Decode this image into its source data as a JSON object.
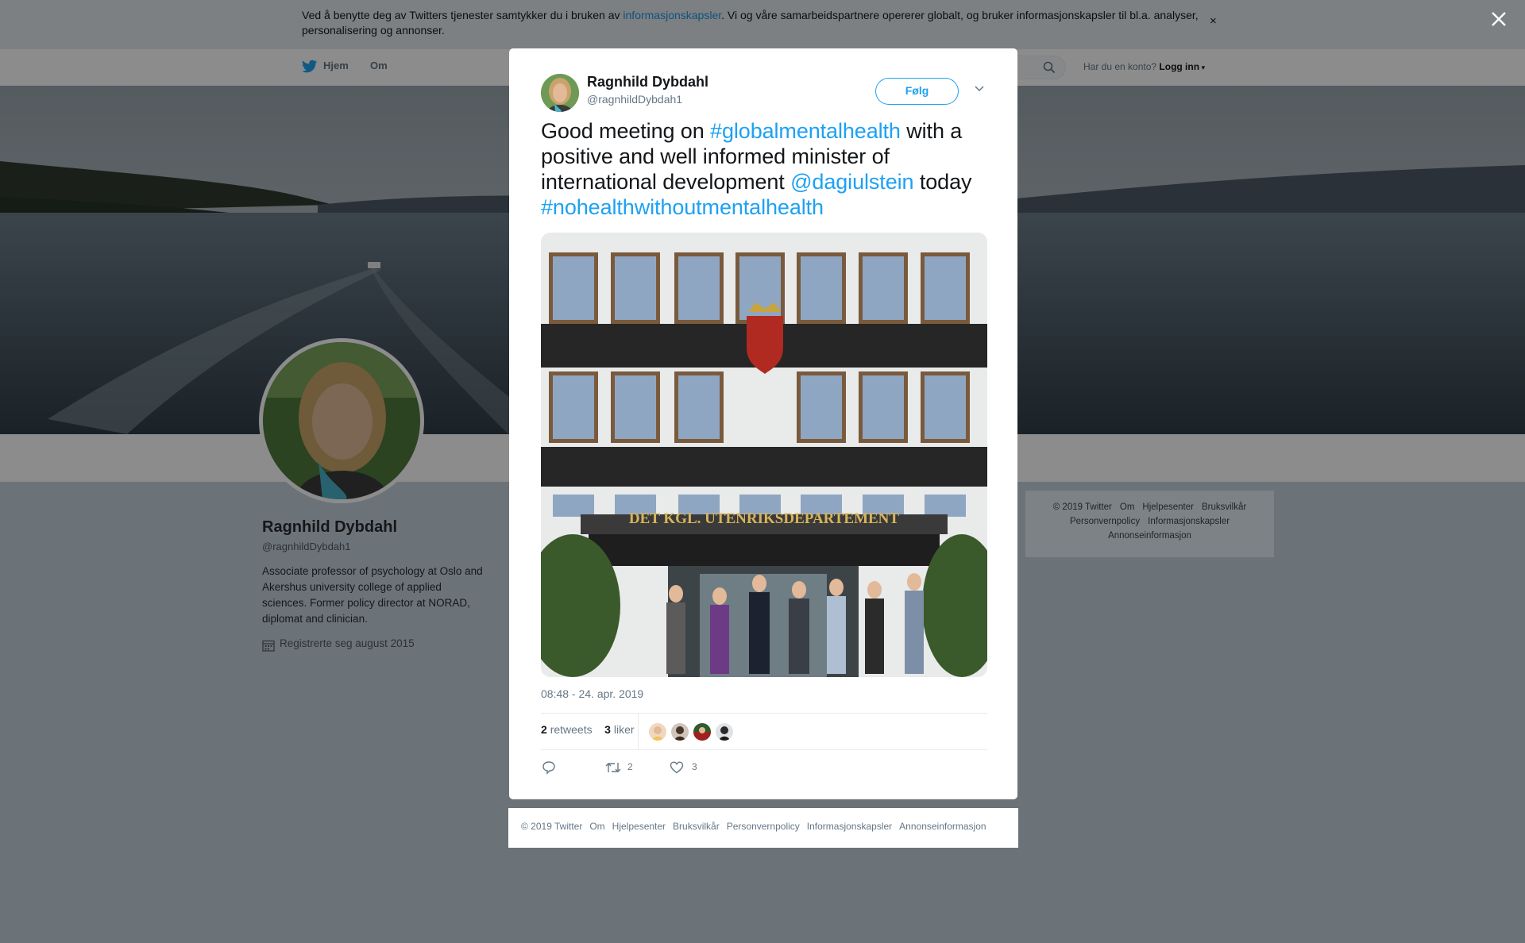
{
  "cookie_banner": {
    "text_before": "Ved å benytte deg av Twitters tjenester samtykker du i bruken av ",
    "link": "informasjonskapsler",
    "text_after": ". Vi og våre samarbeidspartnere opererer globalt, og bruker informasjonskapsler til bl.a. analyser, personalisering og annonser.",
    "close": "×"
  },
  "nav": {
    "home": "Hjem",
    "about": "Om",
    "account_prompt": "Har du en konto?",
    "login": "Logg inn"
  },
  "profile": {
    "name": "Ragnhild Dybdahl",
    "handle": "@ragnhildDybdah1",
    "bio": "Associate professor of psychology at Oslo and Akershus university college of applied sciences. Former policy director at NORAD, diplomat and clinician.",
    "joined": "Registrerte seg august 2015"
  },
  "side_footer": {
    "line1": [
      "© 2019 Twitter",
      "Om",
      "Hjelpesenter",
      "Bruksvilkår"
    ],
    "line2": [
      "Personvernpolicy",
      "Informasjonskapsler"
    ],
    "line3": [
      "Annonseinformasjon"
    ]
  },
  "tweet": {
    "name": "Ragnhild Dybdahl",
    "handle": "@ragnhildDybdah1",
    "follow_label": "Følg",
    "text": {
      "t1": "Good meeting on ",
      "hashtag1": "#globalmentalhealth",
      "t2": " with a positive and well informed minister of international development ",
      "mention": "@dagiulstein",
      "t3": " today ",
      "hashtag2": "#nohealthwithoutmentalhealth"
    },
    "photo_sign": "DET KGL. UTENRIKSDEPARTEMENT",
    "timestamp": "08:48 - 24. apr. 2019",
    "retweets_count": "2",
    "retweets_label": "retweets",
    "likes_count": "3",
    "likes_label": "liker",
    "action_reply_count": "",
    "action_retweet_count": "2",
    "action_like_count": "3"
  },
  "modal_footer": [
    "© 2019 Twitter",
    "Om",
    "Hjelpesenter",
    "Bruksvilkår",
    "Personvernpolicy",
    "Informasjonskapsler",
    "Annonseinformasjon"
  ],
  "colors": {
    "accent": "#1da1f2",
    "link": "#1b95e0",
    "overlay": "#6c7378"
  },
  "icons": [
    "twitter-bird-icon",
    "search-icon",
    "calendar-icon",
    "chevron-down-icon",
    "reply-icon",
    "retweet-icon",
    "heart-icon",
    "close-icon"
  ]
}
